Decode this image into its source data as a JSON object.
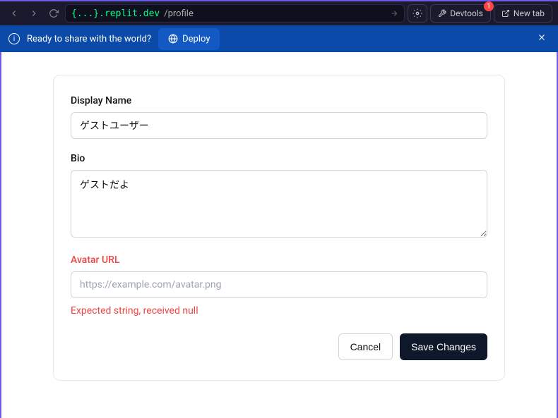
{
  "browser": {
    "url_host": "{...}.replit.dev",
    "url_path": "/profile",
    "devtools_label": "Devtools",
    "devtools_badge": "1",
    "newtab_label": "New tab"
  },
  "deploy_bar": {
    "message": "Ready to share with the world?",
    "button_label": "Deploy"
  },
  "form": {
    "display_name": {
      "label": "Display Name",
      "value": "ゲストユーザー"
    },
    "bio": {
      "label": "Bio",
      "value": "ゲストだよ"
    },
    "avatar_url": {
      "label": "Avatar URL",
      "placeholder": "https://example.com/avatar.png",
      "value": "",
      "error": "Expected string, received null"
    },
    "cancel_label": "Cancel",
    "save_label": "Save Changes"
  }
}
